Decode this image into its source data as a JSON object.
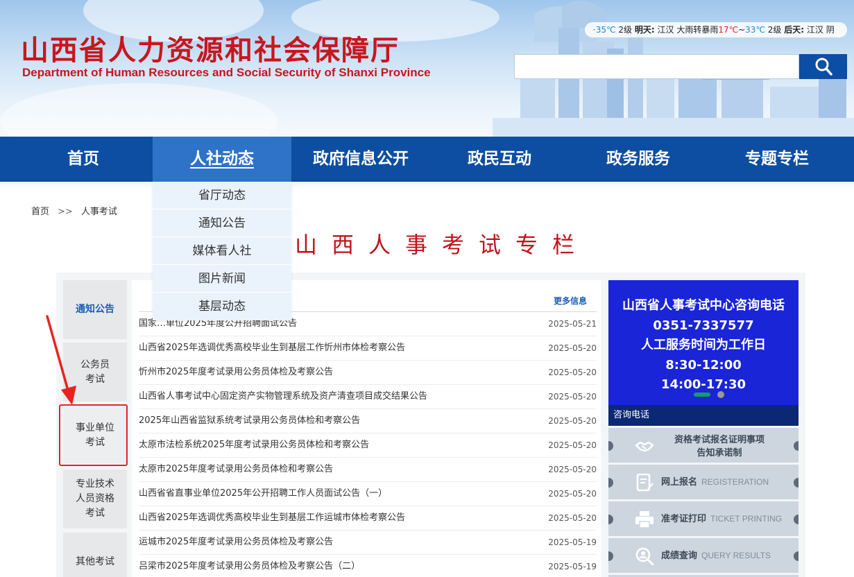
{
  "header": {
    "title_cn": "山西省人力资源和社会保障厅",
    "title_en": "Department of Human Resources and Social Security of Shanxi Province"
  },
  "weather": {
    "today_temp": "·35℃",
    "today_wind": "2级",
    "tomorrow_label": "明天:",
    "tomorrow_city": "江汉",
    "tomorrow_cond": "大雨转暴雨",
    "tomorrow_low": "17℃",
    "tilde": "~",
    "tomorrow_high": "33℃",
    "tomorrow_wind": "2级",
    "after_label": "后天:",
    "after_city": "江汉",
    "after_cond": "阴"
  },
  "search": {
    "placeholder": ""
  },
  "nav": {
    "items": [
      "首页",
      "人社动态",
      "政府信息公开",
      "政民互动",
      "政务服务",
      "专题专栏"
    ]
  },
  "dropdown": {
    "items": [
      "省厅动态",
      "通知公告",
      "媒体看人社",
      "图片新闻",
      "基层动态"
    ]
  },
  "breadcrumb": {
    "home": "首页",
    "sep": ">>",
    "current": "人事考试"
  },
  "page_title": "山西人事考试专栏",
  "sidebar": {
    "tabs": [
      "通知公告",
      "公务员\n考试",
      "事业单位\n考试",
      "专业技术\n人员资格\n考试",
      "其他考试"
    ]
  },
  "list": {
    "more": "更多信息",
    "items": [
      {
        "title": "国家…单位2025年度公开招聘面试公告",
        "date": "2025-05-21"
      },
      {
        "title": "山西省2025年选调优秀高校毕业生到基层工作忻州市体检考察公告",
        "date": "2025-05-20"
      },
      {
        "title": "忻州市2025年度考试录用公务员体检及考察公告",
        "date": "2025-05-20"
      },
      {
        "title": "山西省人事考试中心固定资产实物管理系统及资产清查项目成交结果公告",
        "date": "2025-05-20"
      },
      {
        "title": "2025年山西省监狱系统考试录用公务员体检和考察公告",
        "date": "2025-05-20"
      },
      {
        "title": "太原市法检系统2025年度考试录用公务员体检和考察公告",
        "date": "2025-05-20"
      },
      {
        "title": "太原市2025年度考试录用公务员体检和考察公告",
        "date": "2025-05-20"
      },
      {
        "title": "山西省省直事业单位2025年公开招聘工作人员面试公告（一）",
        "date": "2025-05-20"
      },
      {
        "title": "山西省2025年选调优秀高校毕业生到基层工作运城市体检考察公告",
        "date": "2025-05-20"
      },
      {
        "title": "运城市2025年度考试录用公务员体检及考察公告",
        "date": "2025-05-19"
      },
      {
        "title": "吕梁市2025年度考试录用公务员体检及考察公告（二）",
        "date": "2025-05-19"
      }
    ]
  },
  "banner": {
    "line1": "山西省人事考试中心咨询电话",
    "line2": "0351-7337577",
    "line3": "人工服务时间为工作日",
    "line4": "8:30-12:00",
    "line5": "14:00-17:30",
    "caption": "咨询电话"
  },
  "services": [
    {
      "label": "资格考试报名证明事项\n告知承诺制",
      "en": ""
    },
    {
      "label": "网上报名",
      "en": "REGISTERATION"
    },
    {
      "label": "准考证打印",
      "en": "TICKET PRINTING"
    },
    {
      "label": "成绩查询",
      "en": "QUERY RESULTS"
    }
  ],
  "colors": {
    "nav": "#0d4ea2",
    "nav_active": "#2f73c9",
    "brand_red": "#c8161d",
    "highlight": "#e8231f",
    "banner": "#1a25d8"
  }
}
